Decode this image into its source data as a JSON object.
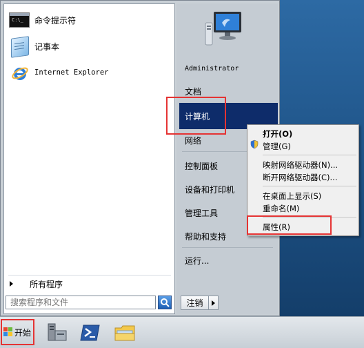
{
  "start_menu": {
    "pinned": [
      {
        "label": "命令提示符",
        "icon": "command-prompt-icon"
      },
      {
        "label": "记事本",
        "icon": "notepad-icon"
      },
      {
        "label": "Internet Explorer",
        "icon": "internet-explorer-icon"
      }
    ],
    "all_programs": "所有程序",
    "search_placeholder": "搜索程序和文件",
    "right_items": {
      "user": "Administrator",
      "documents": "文档",
      "computer": "计算机",
      "network": "网络",
      "control_panel": "控制面板",
      "devices_printers": "设备和打印机",
      "admin_tools": "管理工具",
      "help_support": "帮助和支持",
      "run": "运行..."
    },
    "logout": "注销"
  },
  "context_menu": {
    "open": "打开(O)",
    "manage": "管理(G)",
    "map_drive": "映射网络驱动器(N)...",
    "disconnect_drive": "断开网络驱动器(C)...",
    "show_desktop": "在桌面上显示(S)",
    "rename": "重命名(M)",
    "properties": "属性(R)"
  },
  "taskbar": {
    "start_label": "开始",
    "apps": [
      "server-manager-icon",
      "powershell-icon",
      "file-explorer-icon"
    ]
  },
  "colors": {
    "highlight": "#0e2c6a",
    "annotation_red": "#e53333"
  }
}
